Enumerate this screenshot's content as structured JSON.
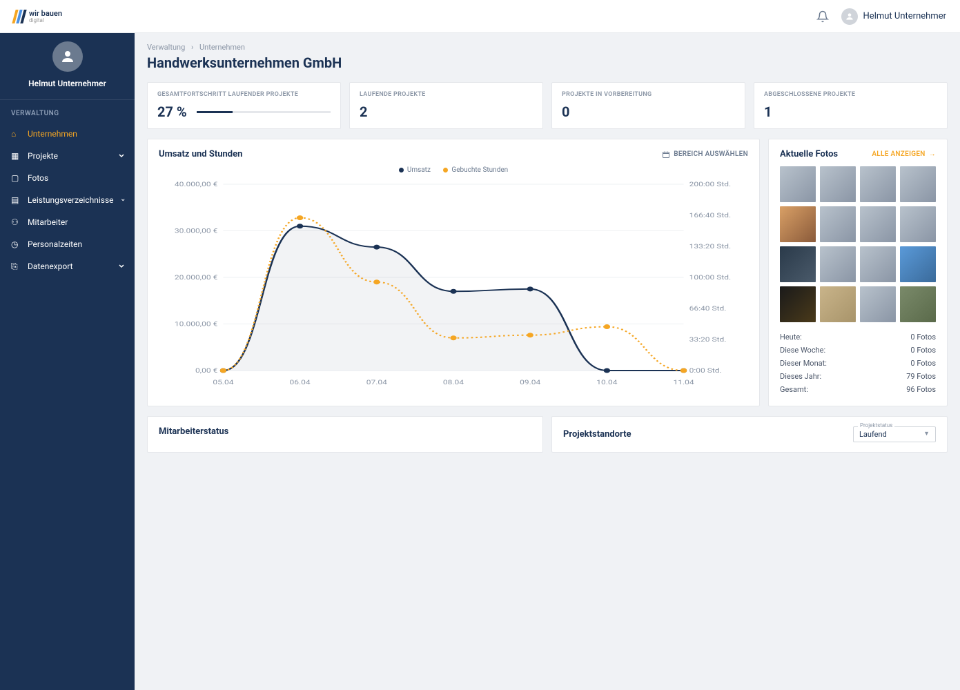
{
  "brand": {
    "name": "wir bauen",
    "sub": "digital"
  },
  "topbar": {
    "user_name": "Helmut Unternehmer"
  },
  "sidebar": {
    "user_name": "Helmut Unternehmer",
    "section": "VERWALTUNG",
    "items": [
      {
        "label": "Unternehmen",
        "active": true,
        "expandable": false
      },
      {
        "label": "Projekte",
        "active": false,
        "expandable": true
      },
      {
        "label": "Fotos",
        "active": false,
        "expandable": false
      },
      {
        "label": "Leistungsverzeichnisse",
        "active": false,
        "expandable": true
      },
      {
        "label": "Mitarbeiter",
        "active": false,
        "expandable": false
      },
      {
        "label": "Personalzeiten",
        "active": false,
        "expandable": false
      },
      {
        "label": "Datenexport",
        "active": false,
        "expandable": true
      }
    ]
  },
  "breadcrumb": {
    "a": "Verwaltung",
    "b": "Unternehmen"
  },
  "page_title": "Handwerksunternehmen GmbH",
  "kpis": [
    {
      "label": "GESAMTFORTSCHRITT LAUFENDER PROJEKTE",
      "value": "27 %",
      "progress": 27
    },
    {
      "label": "LAUFENDE PROJEKTE",
      "value": "2"
    },
    {
      "label": "PROJEKTE IN VORBEREITUNG",
      "value": "0"
    },
    {
      "label": "ABGESCHLOSSENE PROJEKTE",
      "value": "1"
    }
  ],
  "chart_panel": {
    "title": "Umsatz und Stunden",
    "action": "BEREICH AUSWÄHLEN",
    "legend": {
      "a": "Umsatz",
      "b": "Gebuchte Stunden"
    }
  },
  "chart_data": {
    "type": "line",
    "x": [
      "05.04",
      "06.04",
      "07.04",
      "08.04",
      "09.04",
      "10.04",
      "11.04"
    ],
    "series": [
      {
        "name": "Umsatz",
        "axis": "left",
        "values": [
          0,
          31000,
          26500,
          17000,
          17500,
          0,
          0
        ]
      },
      {
        "name": "Gebuchte Stunden",
        "axis": "right",
        "values": [
          0,
          164,
          95,
          35,
          38,
          47,
          0
        ]
      }
    ],
    "left_axis": {
      "label": "€",
      "ticks": [
        "0,00 €",
        "10.000,00 €",
        "20.000,00 €",
        "30.000,00 €",
        "40.000,00 €"
      ],
      "range": [
        0,
        40000
      ]
    },
    "right_axis": {
      "label": "Std.",
      "ticks": [
        "0:00 Std.",
        "33:20 Std.",
        "66:40 Std.",
        "100:00 Std.",
        "133:20 Std.",
        "166:40 Std.",
        "200:00 Std."
      ],
      "range": [
        0,
        200
      ]
    }
  },
  "photos_panel": {
    "title": "Aktuelle Fotos",
    "action": "ALLE ANZEIGEN",
    "stats": [
      {
        "label": "Heute:",
        "value": "0 Fotos"
      },
      {
        "label": "Diese Woche:",
        "value": "0 Fotos"
      },
      {
        "label": "Dieser Monat:",
        "value": "0 Fotos"
      },
      {
        "label": "Dieses Jahr:",
        "value": "79 Fotos"
      },
      {
        "label": "Gesamt:",
        "value": "96 Fotos"
      }
    ]
  },
  "bottom": {
    "left_title": "Mitarbeiterstatus",
    "right_title": "Projektstandorte",
    "select_label": "Projektstatus",
    "select_value": "Laufend"
  }
}
